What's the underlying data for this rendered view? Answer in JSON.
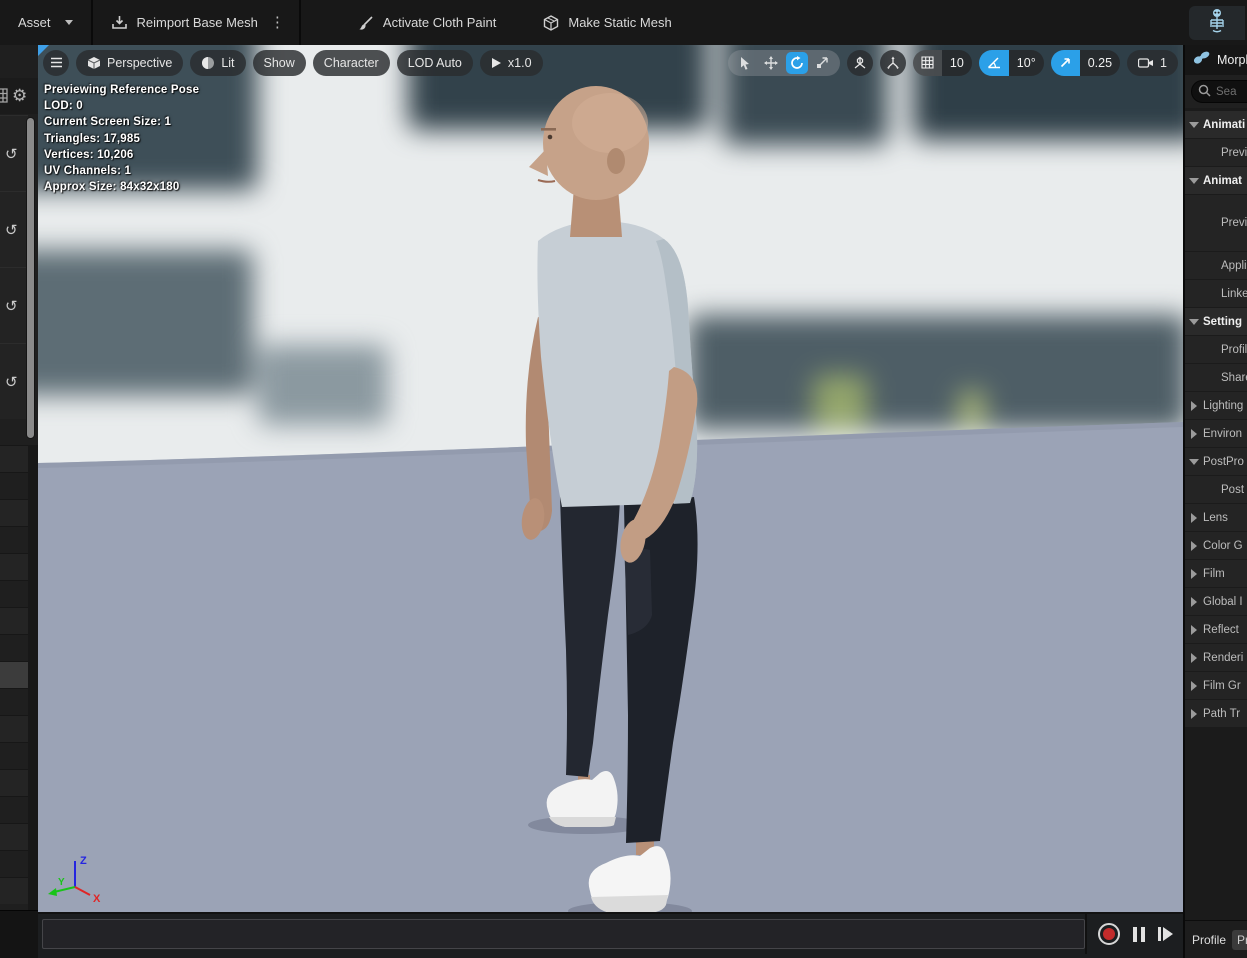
{
  "top_toolbar": {
    "asset_label": "Asset",
    "reimport_label": "Reimport Base Mesh",
    "cloth_label": "Activate Cloth Paint",
    "staticmesh_label": "Make Static Mesh",
    "kebab_glyph": "⋮"
  },
  "editor_mode": {
    "skeletal_mesh_tab_icon": "skeleton-icon"
  },
  "viewport": {
    "toolbar": {
      "perspective": "Perspective",
      "lit": "Lit",
      "show": "Show",
      "character": "Character",
      "lod": "LOD Auto",
      "speed": "x1.0",
      "grid_snap_value": "10",
      "angle_snap_value": "10°",
      "scale_snap_value": "0.25",
      "camera_speed_value": "1"
    },
    "stats": [
      "Previewing Reference Pose",
      "LOD: 0",
      "Current Screen Size: 1",
      "Triangles: 17,985",
      "Vertices: 10,206",
      "UV Channels: 1",
      "Approx Size: 84x32x180"
    ],
    "axis": {
      "x": "X",
      "y": "Y",
      "z": "Z"
    }
  },
  "left_strip": {
    "gear_glyph": "⚙",
    "undo_glyph": "↺",
    "reset_row_count": 4,
    "property_row_count": 17,
    "highlighted_row_index": 8
  },
  "right_panel": {
    "tab_label": "Morph",
    "search_placeholder": "Sea",
    "rows": [
      {
        "label": "Animati",
        "bold": true,
        "arrow": "down",
        "indent": false
      },
      {
        "label": "Preview",
        "bold": false,
        "arrow": "none",
        "indent": true
      },
      {
        "label": "Animat",
        "bold": true,
        "arrow": "down",
        "indent": false
      },
      {
        "label": "Preview",
        "bold": false,
        "arrow": "none",
        "indent": true,
        "tall": true
      },
      {
        "label": "Applica",
        "bold": false,
        "arrow": "none",
        "indent": true
      },
      {
        "label": "Linked",
        "bold": false,
        "arrow": "none",
        "indent": true
      },
      {
        "label": "Setting",
        "bold": true,
        "arrow": "down",
        "indent": false
      },
      {
        "label": "Profile",
        "bold": false,
        "arrow": "none",
        "indent": true
      },
      {
        "label": "Shared",
        "bold": false,
        "arrow": "none",
        "indent": true
      },
      {
        "label": "Lighting",
        "bold": false,
        "arrow": "right",
        "indent": false
      },
      {
        "label": "Environ",
        "bold": false,
        "arrow": "right",
        "indent": false
      },
      {
        "label": "PostPro",
        "bold": false,
        "arrow": "down",
        "indent": false
      },
      {
        "label": "Post Pr",
        "bold": false,
        "arrow": "none",
        "indent": true
      },
      {
        "label": "Lens",
        "bold": false,
        "arrow": "right",
        "indent": false
      },
      {
        "label": "Color G",
        "bold": false,
        "arrow": "right",
        "indent": false
      },
      {
        "label": "Film",
        "bold": false,
        "arrow": "right",
        "indent": false
      },
      {
        "label": "Global I",
        "bold": false,
        "arrow": "right",
        "indent": false
      },
      {
        "label": "Reflect",
        "bold": false,
        "arrow": "right",
        "indent": false
      },
      {
        "label": "Renderi",
        "bold": false,
        "arrow": "right",
        "indent": false
      },
      {
        "label": "Film Gr",
        "bold": false,
        "arrow": "right",
        "indent": false
      },
      {
        "label": "Path Tr",
        "bold": false,
        "arrow": "right",
        "indent": false
      }
    ],
    "footer": {
      "profile_label": "Profile",
      "profile_value": "Pr"
    }
  },
  "colors": {
    "accent_blue": "#2ba0e8",
    "record_red": "#c22b2b",
    "floor": "#9ba3b6",
    "skeleton_icon_blue": "#a4d2ea"
  }
}
